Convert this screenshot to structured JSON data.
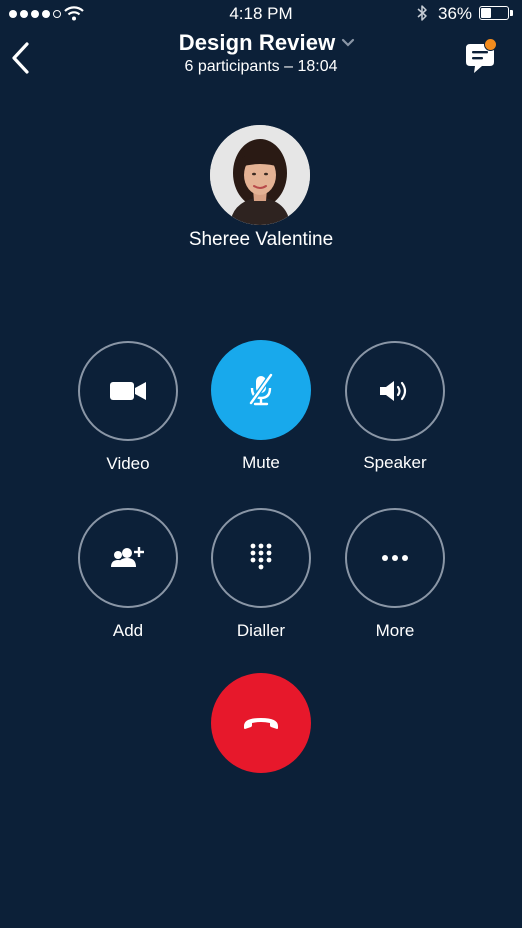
{
  "status_bar": {
    "time": "4:18 PM",
    "battery_percent": "36%",
    "battery_level": 0.36,
    "signal_bars_filled": 4,
    "signal_bars_total": 5,
    "icons": [
      "signal-icon",
      "wifi-icon",
      "bluetooth-icon",
      "battery-icon"
    ]
  },
  "header": {
    "title": "Design Review",
    "subtitle": "6 participants – 18:04",
    "icons": [
      "back-chevron-icon",
      "chevron-down-icon",
      "chat-icon"
    ]
  },
  "caller": {
    "name": "Sheree Valentine"
  },
  "controls": [
    {
      "id": "video",
      "label": "Video",
      "icon": "video-camera-icon"
    },
    {
      "id": "mute",
      "label": "Mute",
      "icon": "mic-off-icon",
      "active": true
    },
    {
      "id": "speaker",
      "label": "Speaker",
      "icon": "speaker-icon"
    },
    {
      "id": "add",
      "label": "Add",
      "icon": "add-people-icon"
    },
    {
      "id": "dialler",
      "label": "Dialler",
      "icon": "dialpad-icon"
    },
    {
      "id": "more",
      "label": "More",
      "icon": "more-icon"
    }
  ],
  "end_call": {
    "icon": "hang-up-icon"
  },
  "colors": {
    "background": "#0c2038",
    "accent": "#18a9ec",
    "end_call": "#e7182b",
    "badge": "#f28b1d",
    "ring": "#8a96a6"
  }
}
